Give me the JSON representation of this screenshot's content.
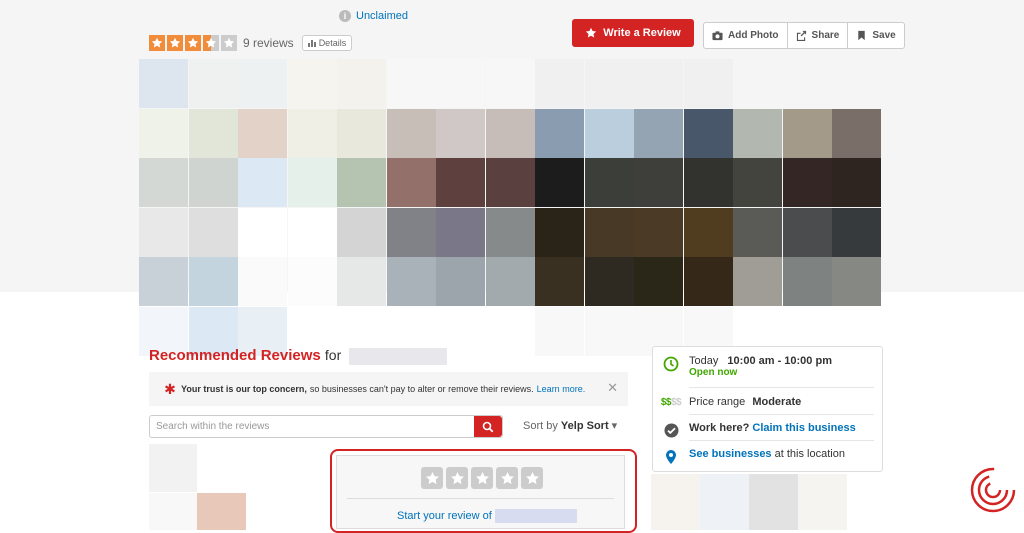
{
  "header": {
    "unclaimed_label": "Unclaimed",
    "info_icon": "i",
    "rating_stars": 3.5,
    "rating_max": 5,
    "reviews_count": "9 reviews",
    "details_label": "Details"
  },
  "actions": {
    "write_review": "Write a Review",
    "add_photo": "Add Photo",
    "share": "Share",
    "save": "Save"
  },
  "colors": {
    "brand_red": "#d32323",
    "star_orange": "#f08c3a",
    "link_blue": "#0073bb",
    "open_green": "#41a700"
  },
  "reviews": {
    "title": "Recommended Reviews",
    "for_label": "for",
    "trust_bold": "Your trust is our top concern,",
    "trust_text": "so businesses can't pay to alter or remove their reviews.",
    "trust_link": "Learn more.",
    "search_placeholder": "Search within the reviews",
    "sort_label": "Sort by",
    "sort_value": "Yelp Sort",
    "start_review": "Start your review of"
  },
  "info": {
    "today_label": "Today",
    "hours": "10:00 am - 10:00 pm",
    "open_now": "Open now",
    "price_symbols_active": "$$",
    "price_symbols_inactive": "$$",
    "price_label": "Price range",
    "price_value": "Moderate",
    "work_here": "Work here?",
    "claim_link": "Claim this business",
    "see_businesses": "See businesses",
    "at_location": "at this location"
  }
}
